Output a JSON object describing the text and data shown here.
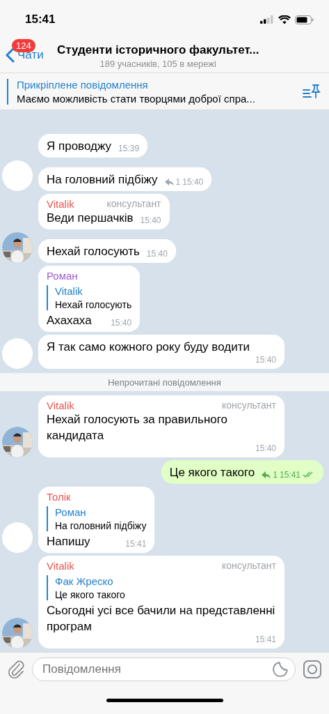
{
  "status_bar": {
    "time": "15:41"
  },
  "header": {
    "back_label": "Чати",
    "unread_badge": "124",
    "title": "Студенти історичного факультет...",
    "subtitle": "189 учасників, 105 в мережі"
  },
  "pinned": {
    "title": "Прикріплене повідомлення",
    "text": "Маємо можливість стати творцями доброї спра..."
  },
  "messages": [
    {
      "kind": "message",
      "outgoing": false,
      "text": "Я проводжу",
      "time": "15:39"
    },
    {
      "kind": "message",
      "outgoing": false,
      "text": "На головний підбіжу",
      "time": "15:40",
      "replies": "1",
      "avatar": {
        "kind": "blank"
      }
    },
    {
      "kind": "message",
      "outgoing": false,
      "sender": "Vitalik",
      "color": "#e8544f",
      "role": "консультант",
      "text": "Веди першачків",
      "time": "15:40"
    },
    {
      "kind": "message",
      "outgoing": false,
      "text": "Нехай голосують",
      "time": "15:40"
    },
    {
      "kind": "message",
      "outgoing": false,
      "sender": "Роман",
      "color": "#9b59d0",
      "reply": {
        "name": "Vitalik",
        "text": "Нехай голосують"
      },
      "text": "Ахахаха",
      "time": "15:40"
    },
    {
      "kind": "message",
      "outgoing": false,
      "text": "Я так само кожного року буду водити",
      "time": "15:40",
      "avatar": {
        "kind": "blank"
      }
    },
    {
      "kind": "divider",
      "text": "Непрочитані повідомлення"
    },
    {
      "kind": "message",
      "outgoing": false,
      "sender": "Vitalik",
      "color": "#e8544f",
      "role": "консультант",
      "text": "Нехай голосують за правильного кандидата",
      "time": "15:40"
    },
    {
      "kind": "message",
      "outgoing": true,
      "text": "Це якого такого",
      "time": "15:41",
      "replies": "1",
      "read": true
    },
    {
      "kind": "message",
      "outgoing": false,
      "sender": "Толік",
      "color": "#e8544f",
      "reply": {
        "name": "Роман",
        "text": "На головний підбіжу"
      },
      "text": "Напишу",
      "time": "15:41",
      "avatar": {
        "kind": "blank"
      }
    },
    {
      "kind": "message",
      "outgoing": false,
      "sender": "Vitalik",
      "color": "#e8544f",
      "role": "консультант",
      "reply": {
        "name": "Фак Жреско",
        "text": "Це якого такого"
      },
      "text": "Сьогодні усі все бачили на представленні програм",
      "time": "15:41"
    }
  ],
  "composer": {
    "placeholder": "Повідомлення"
  }
}
